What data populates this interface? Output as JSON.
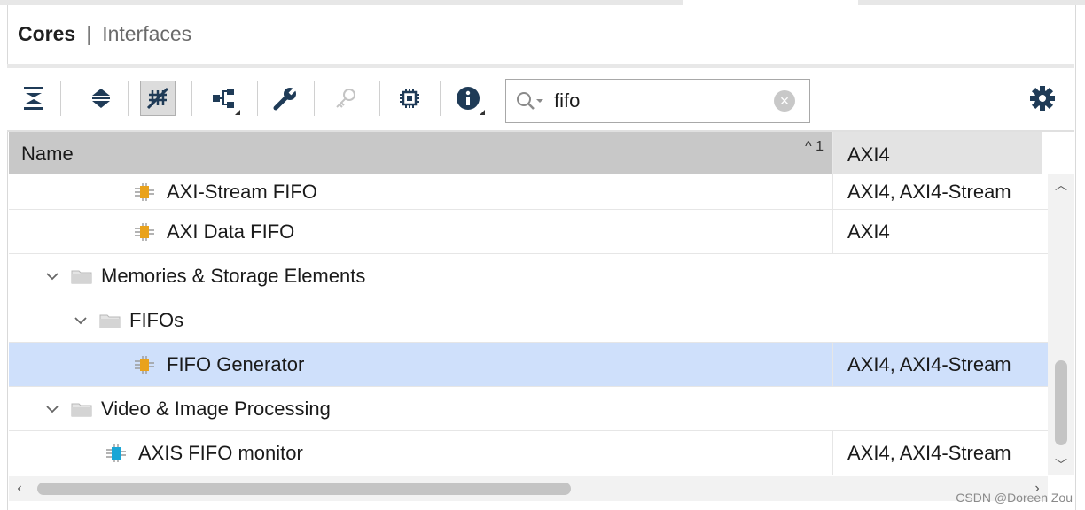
{
  "tabs": {
    "active": "Cores",
    "separator": "|",
    "inactive": "Interfaces"
  },
  "toolbar": {
    "buttons": [
      {
        "icon": "collapse-all-icon"
      },
      {
        "icon": "expand-all-icon"
      },
      {
        "icon": "hide-unsupported-icon",
        "pressed": true
      },
      {
        "icon": "hierarchy-icon"
      },
      {
        "icon": "customize-wrench-icon"
      },
      {
        "icon": "key-icon",
        "disabled": true
      },
      {
        "icon": "chip-icon"
      },
      {
        "icon": "info-icon"
      }
    ],
    "search_value": "fifo",
    "settings_icon": "gear-icon"
  },
  "table": {
    "columns": {
      "name": "Name",
      "sort": "^ 1",
      "axi": "AXI4"
    },
    "rows": [
      {
        "kind": "ip",
        "level": 3,
        "name": "AXI-Stream FIFO",
        "axi": "AXI4, AXI4-Stream",
        "icon_color": "#e9a21c"
      },
      {
        "kind": "ip",
        "level": 3,
        "name": "AXI Data FIFO",
        "axi": "AXI4",
        "icon_color": "#e9a21c"
      },
      {
        "kind": "folder",
        "level": 1,
        "name": "Memories & Storage Elements",
        "axi": ""
      },
      {
        "kind": "folder",
        "level": 2,
        "name": "FIFOs",
        "axi": ""
      },
      {
        "kind": "ip",
        "level": 3,
        "name": "FIFO Generator",
        "axi": "AXI4, AXI4-Stream",
        "icon_color": "#e9a21c",
        "selected": true
      },
      {
        "kind": "folder",
        "level": 1,
        "name": "Video & Image Processing",
        "axi": ""
      },
      {
        "kind": "ip",
        "level": 2,
        "name": "AXIS FIFO monitor",
        "axi": "AXI4, AXI4-Stream",
        "icon_color": "#1aa6d6"
      }
    ]
  },
  "watermark": "CSDN @Doreen Zou",
  "colors": {
    "selected_row": "#cfe0fb",
    "header_name_bg": "#c8c8c8",
    "ip_orange": "#e9a21c",
    "ip_blue": "#1aa6d6"
  }
}
